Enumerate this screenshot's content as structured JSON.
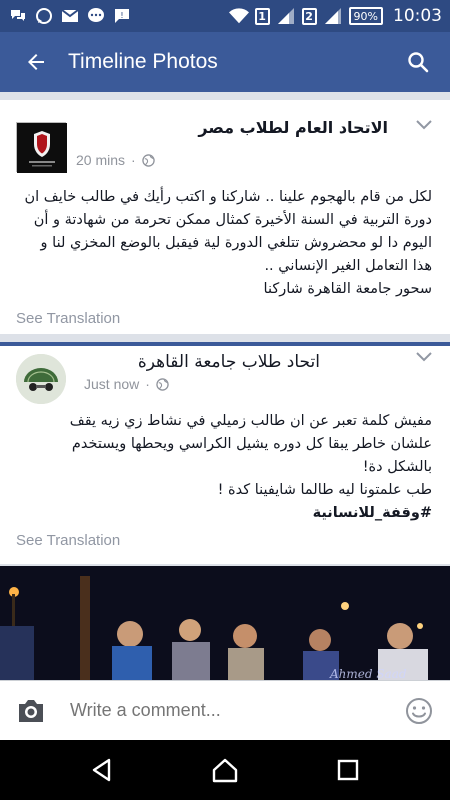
{
  "status_bar": {
    "time": "10:03",
    "battery": "90%",
    "sim1": "1",
    "sim2": "2",
    "icons": [
      "chat-bubbles-icon",
      "whatsapp-icon",
      "mail-icon",
      "messenger-icon",
      "sms-icon",
      "wifi-icon",
      "signal-icon"
    ]
  },
  "appbar": {
    "title": "Timeline Photos",
    "back_icon": "arrow-left-icon",
    "search_icon": "search-icon"
  },
  "posts": [
    {
      "author": "الاتحاد العام لطلاب مصر",
      "time": "20 mins",
      "privacy_icon": "globe-icon",
      "lines": [
        "لكل من قام بالهجوم علينا .. شاركنا و اكتب رأيك في طالب خايف ان",
        "دورة التربية في السنة الأخيرة كمثال ممكن تحرمة من شهادتة و أن",
        "اليوم دا لو محضروش تتلغي الدورة لية فيقبل بالوضع المخزي لنا و",
        "هذا التعامل الغير الإنساني ..",
        "سحور جامعة القاهرة شاركنا"
      ],
      "see_translation": "See Translation"
    },
    {
      "author": "اتحاد طلاب جامعة القاهرة",
      "time": "Just now",
      "privacy_icon": "globe-icon",
      "lines": [
        "مفيش كلمة تعبر عن ان طالب زميلي في نشاط زي زيه يقف",
        "علشان خاطر يبقا كل دوره يشيل الكراسي ويحطها ويستخدم",
        "بالشكل دة!",
        "طب علمتونا ليه طالما شايفينا كدة !"
      ],
      "hashtag": "#وقفة_للانسانية",
      "see_translation": "See Translation",
      "photo_watermark": "Ahmed Saad"
    }
  ],
  "comment_bar": {
    "placeholder": "Write a comment..."
  },
  "colors": {
    "status_bar": "#2e4a82",
    "app_bar": "#3b5a99",
    "feed_bg": "#dde1e8"
  }
}
